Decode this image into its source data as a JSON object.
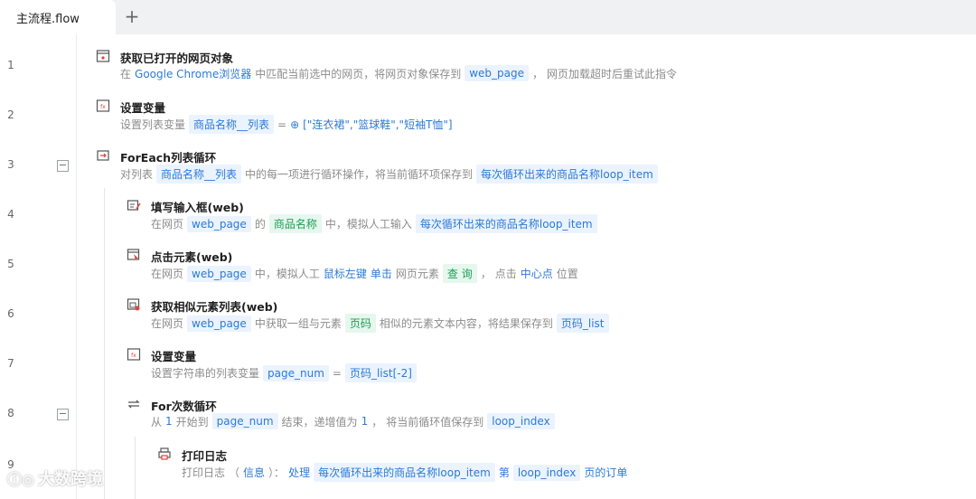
{
  "tabs": [
    {
      "label": "主流程.flow"
    }
  ],
  "tab_add": "+",
  "steps": [
    {
      "line": "1",
      "title": "获取已打开的网页对象",
      "d": [
        "在",
        "Google Chrome浏览器",
        "中匹配当前选中的网页，将网页对象保存到",
        "web_page",
        "，",
        "网页加载超时后重试此指令"
      ]
    },
    {
      "line": "2",
      "title": "设置变量",
      "d": [
        "设置列表变量",
        "商品名称__列表",
        "=",
        "[\"连衣裙\",\"篮球鞋\",\"短袖T恤\"]"
      ]
    },
    {
      "line": "3",
      "title": "ForEach列表循环",
      "d": [
        "对列表",
        "商品名称__列表",
        "中的每一项进行循环操作，将当前循环项保存到",
        "每次循环出来的商品名称loop_item"
      ]
    },
    {
      "line": "4",
      "title": "填写输入框(web)",
      "d": [
        "在网页",
        "web_page",
        "的",
        "商品名称",
        "中，模拟人工输入",
        "每次循环出来的商品名称loop_item"
      ]
    },
    {
      "line": "5",
      "title": "点击元素(web)",
      "d": [
        "在网页",
        "web_page",
        "中，模拟人工",
        "鼠标左键",
        "单击",
        "网页元素",
        "查 询",
        "，",
        "点击",
        "中心点",
        "位置"
      ]
    },
    {
      "line": "6",
      "title": "获取相似元素列表(web)",
      "d": [
        "在网页",
        "web_page",
        "中获取一组与元素",
        "页码",
        "相似的元素文本内容，将结果保存到",
        "页码_list"
      ]
    },
    {
      "line": "7",
      "title": "设置变量",
      "d": [
        "设置字符串的列表变量",
        "page_num",
        "=",
        "页码_list[-2]"
      ]
    },
    {
      "line": "8",
      "title": "For次数循环",
      "d": [
        "从",
        "1",
        "开始到",
        "page_num",
        "结束，递增值为",
        "1",
        "，",
        "将当前循环值保存到",
        "loop_index"
      ]
    },
    {
      "line": "9",
      "title": "打印日志",
      "d": [
        "打印日志",
        "（",
        "信息",
        "）：",
        "处理",
        "每次循环出来的商品名称loop_item",
        "第",
        "loop_index",
        "页的订单"
      ]
    }
  ],
  "fold_symbol": "−",
  "watermark": "大数跨境"
}
